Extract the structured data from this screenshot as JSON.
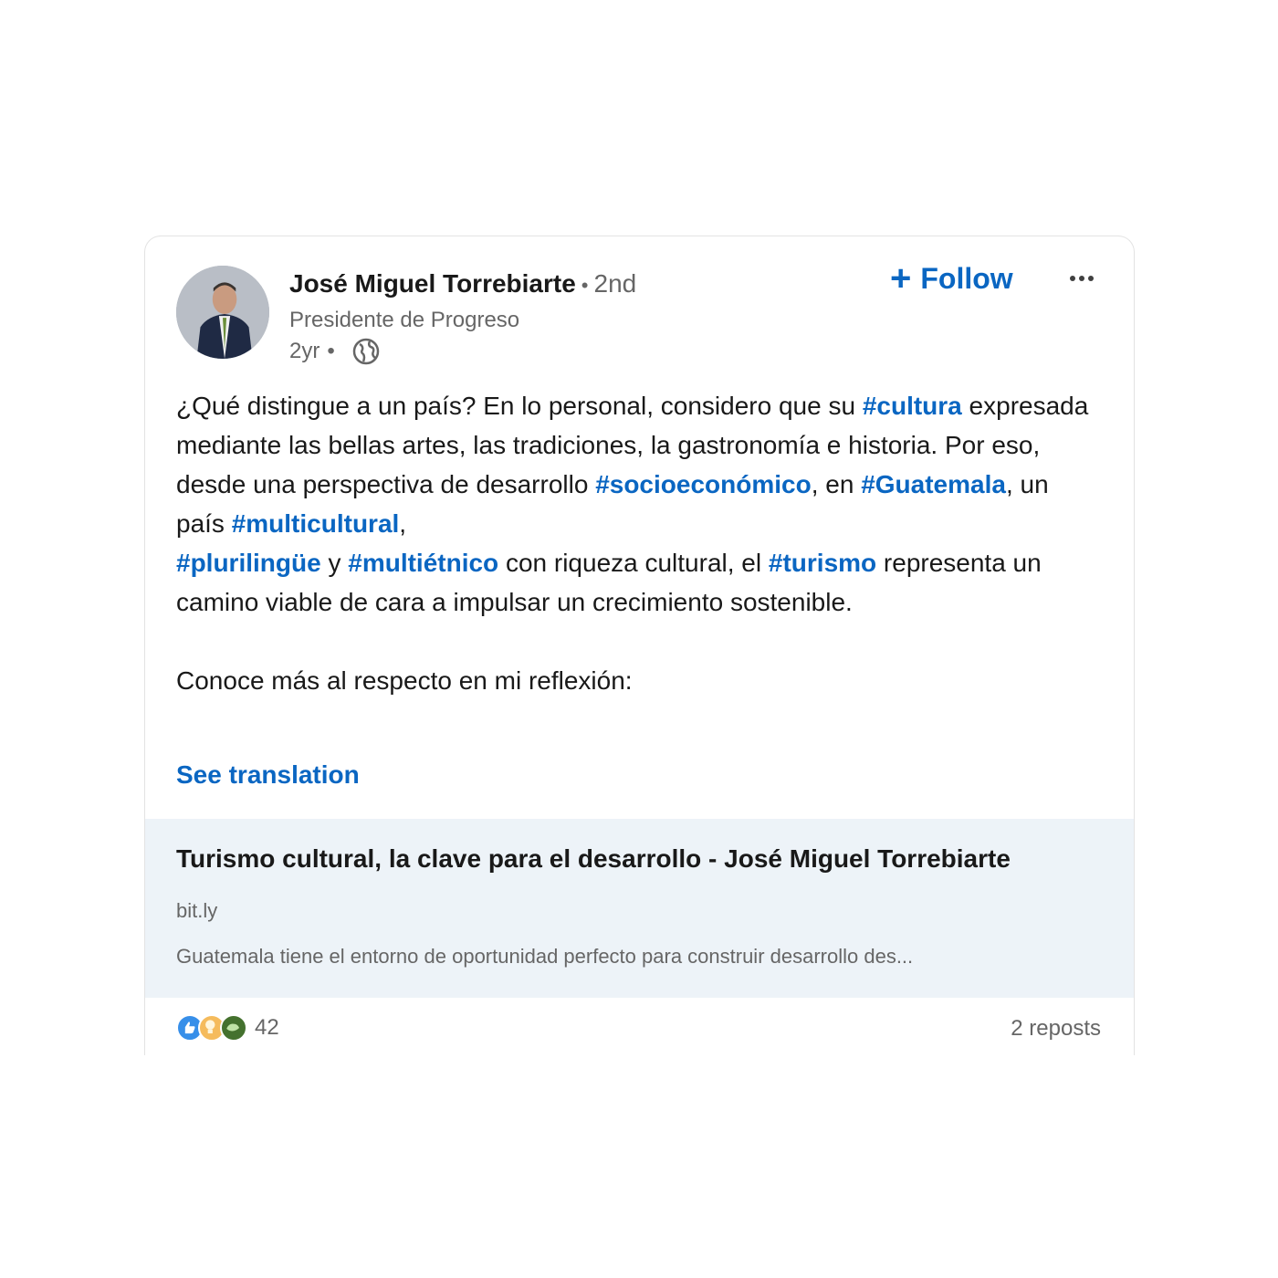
{
  "post": {
    "author": {
      "name": "José Miguel Torrebiarte",
      "separator": "•",
      "degree": "2nd",
      "headline": "Presidente de Progreso",
      "time": "2yr",
      "time_separator": "•",
      "visibility_icon": "globe-icon"
    },
    "actions": {
      "follow_plus": "+",
      "follow_label": "Follow",
      "more_icon": "ellipsis-icon"
    },
    "body": {
      "p1_a": "¿Qué distingue a un país? En lo personal, considero que su ",
      "tag_cultura": "#cultura",
      "p1_b": " expresada mediante las bellas artes, las tradiciones, la gastronomía e historia. Por eso, desde una perspectiva de desarrollo ",
      "tag_socioeconomico": "#socioeconómico",
      "p1_c": ", en ",
      "tag_guatemala": "#Guatemala",
      "p1_d": ", un país ",
      "tag_multicultural": "#multicultural",
      "p1_e": ", ",
      "tag_plurilingue": "#plurilingüe",
      "p1_f": " y ",
      "tag_multietnico": "#multiétnico",
      "p1_g": " con riqueza cultural, el ",
      "tag_turismo": "#turismo",
      "p1_h": " representa un camino viable de cara a impulsar un crecimiento sostenible.",
      "p2": "Conoce más al respecto en mi reflexión:"
    },
    "see_translation": "See translation",
    "link_preview": {
      "title": "Turismo cultural, la clave para el desarrollo - José Miguel Torrebiarte",
      "domain": "bit.ly",
      "description": "Guatemala tiene el entorno de oportunidad perfecto para construir desarrollo des..."
    },
    "social": {
      "reaction_icons": [
        "like-icon",
        "insightful-icon",
        "support-icon"
      ],
      "reaction_count": "42",
      "reposts": "2 reposts"
    },
    "colors": {
      "link_blue": "#0a66c2",
      "preview_bg": "#edf3f8",
      "muted_text": "#666666"
    }
  }
}
